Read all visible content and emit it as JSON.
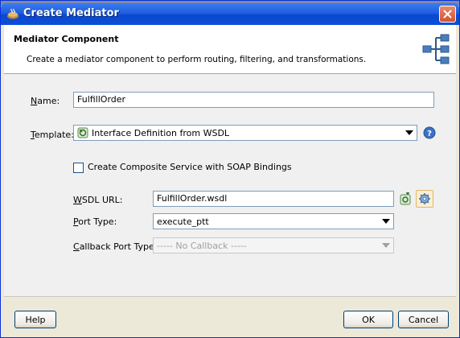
{
  "window": {
    "title": "Create Mediator"
  },
  "header": {
    "title": "Mediator Component",
    "subtitle": "Create a mediator component to perform routing, filtering, and transformations."
  },
  "form": {
    "name": {
      "label_mnemonic": "N",
      "label_rest": "ame:",
      "value": "FulfillOrder"
    },
    "template": {
      "label_mnemonic": "T",
      "label_rest": "emplate:",
      "value": "Interface Definition from WSDL"
    },
    "soap_checkbox": {
      "label": "Create Composite Service with SOAP Bindings",
      "checked": false
    },
    "wsdl_url": {
      "label_mnemonic": "W",
      "label_rest": "SDL URL:",
      "value": "FulfillOrder.wsdl"
    },
    "port_type": {
      "label_mnemonic": "P",
      "label_rest": "ort Type:",
      "value": "execute_ptt"
    },
    "callback_port_type": {
      "label_mnemonic": "C",
      "label_rest": "allback Port Type:",
      "value": "----- No Callback -----"
    }
  },
  "buttons": {
    "help": "Help",
    "ok": "OK",
    "cancel": "Cancel"
  },
  "icons": {
    "title": "mediator-app-icon",
    "header": "mediator-routing-icon",
    "template_item": "wsdl-interface-icon",
    "help": "help-question-icon",
    "wsdl_browse": "find-wsdl-icon",
    "wsdl_generate": "generate-wsdl-gear-icon",
    "close": "close-icon"
  },
  "colors": {
    "titlebar": "#0a48cf",
    "close": "#d7502b",
    "accent": "#1c5180"
  }
}
